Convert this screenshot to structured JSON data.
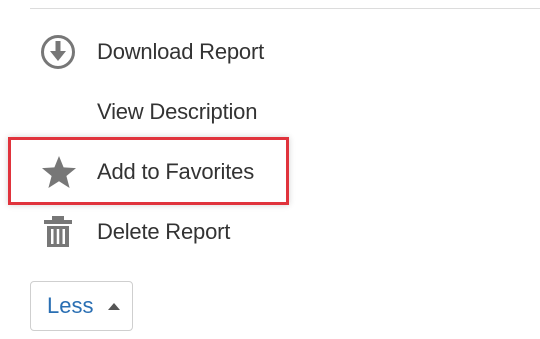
{
  "menu": {
    "items": [
      {
        "label": "Download Report",
        "icon": "download-icon"
      },
      {
        "label": "View Description",
        "icon": ""
      },
      {
        "label": "Add to Favorites",
        "icon": "star-icon",
        "highlighted": true
      },
      {
        "label": "Delete Report",
        "icon": "trash-icon"
      }
    ]
  },
  "toggle": {
    "label": "Less",
    "icon": "caret-up-icon"
  },
  "colors": {
    "highlight_border": "#e0333c",
    "link_blue": "#2a6fb3",
    "icon_gray": "#777777",
    "text": "#333333"
  }
}
